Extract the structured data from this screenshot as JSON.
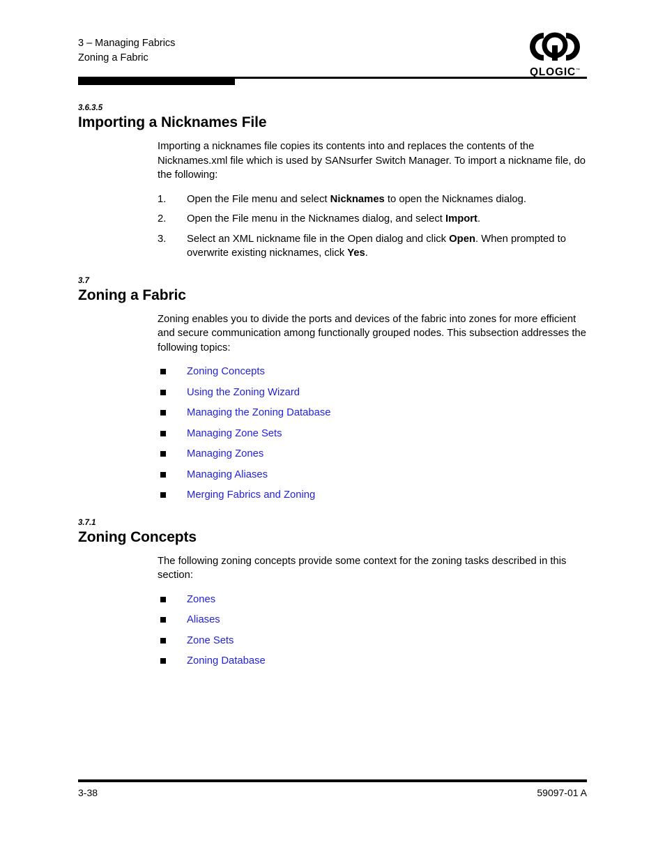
{
  "header": {
    "line1": "3 – Managing Fabrics",
    "line2": "Zoning a Fabric",
    "logo_word": "QLOGIC",
    "logo_tm": "™"
  },
  "sections": [
    {
      "number": "3.6.3.5",
      "title": "Importing a Nicknames File",
      "paragraph": "Importing a nicknames file copies its contents into and replaces the contents of the Nicknames.xml file which is used by SANsurfer Switch Manager. To import a nickname file, do the following:",
      "steps": [
        {
          "marker": "1.",
          "pre": "Open the File menu and select ",
          "bold": "Nicknames",
          "post": " to open the Nicknames dialog."
        },
        {
          "marker": "2.",
          "pre": "Open the File menu in the Nicknames dialog, and select ",
          "bold": "Import",
          "post": "."
        },
        {
          "marker": "3.",
          "pre": "Select an XML nickname file in the Open dialog and click ",
          "bold": "Open",
          "mid": ". When prompted to overwrite existing nicknames, click ",
          "bold2": "Yes",
          "post": "."
        }
      ]
    },
    {
      "number": "3.7",
      "title": "Zoning a Fabric",
      "paragraph": "Zoning enables you to divide the ports and devices of the fabric into zones for more efficient and secure communication among functionally grouped nodes. This subsection addresses the following topics:",
      "links": [
        "Zoning Concepts",
        "Using the Zoning Wizard",
        "Managing the Zoning Database",
        "Managing Zone Sets",
        "Managing Zones",
        "Managing Aliases",
        "Merging Fabrics and Zoning"
      ]
    },
    {
      "number": "3.7.1",
      "title": "Zoning Concepts",
      "paragraph": "The following zoning concepts provide some context for the zoning tasks described in this section:",
      "links": [
        "Zones",
        "Aliases",
        "Zone Sets",
        "Zoning Database"
      ]
    }
  ],
  "footer": {
    "page_number": "3-38",
    "doc_number": "59097-01 A"
  },
  "colors": {
    "link": "#2222dd",
    "rule": "#000000",
    "text": "#000000"
  }
}
